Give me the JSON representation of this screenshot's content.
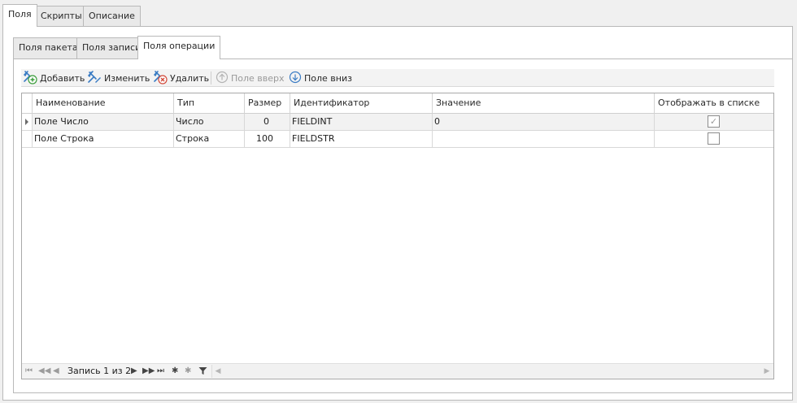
{
  "outer_tabs": [
    {
      "label": "Поля",
      "active": true
    },
    {
      "label": "Скрипты",
      "active": false
    },
    {
      "label": "Описание",
      "active": false
    }
  ],
  "inner_tabs": [
    {
      "label": "Поля пакета",
      "active": false
    },
    {
      "label": "Поля записи",
      "active": false
    },
    {
      "label": "Поля операции",
      "active": true
    }
  ],
  "toolbar": {
    "add_label": "Добавить",
    "edit_label": "Изменить",
    "delete_label": "Удалить",
    "up_label": "Поле вверх",
    "down_label": "Поле вниз"
  },
  "grid": {
    "columns": [
      "Наименование",
      "Тип",
      "Размер",
      "Идентификатор",
      "Значение",
      "Отображать в списке"
    ],
    "rows": [
      {
        "name": "Поле Число",
        "type": "Число",
        "size": "0",
        "id": "FIELDINT",
        "value": "0",
        "show_in_list": true,
        "selected": true
      },
      {
        "name": "Поле Строка",
        "type": "Строка",
        "size": "100",
        "id": "FIELDSTR",
        "value": "",
        "show_in_list": false,
        "selected": false
      }
    ],
    "navigator_text": "Запись 1 из 2"
  },
  "colors": {
    "background": "#f0f0f0",
    "panel": "#ffffff",
    "border": "#b9b9b9",
    "selected_row": "#f2f2f2",
    "disabled_text": "#9a9a9a",
    "icon_blue": "#3a7cc4",
    "icon_green": "#3a9d3a",
    "icon_red": "#d24a3a"
  }
}
